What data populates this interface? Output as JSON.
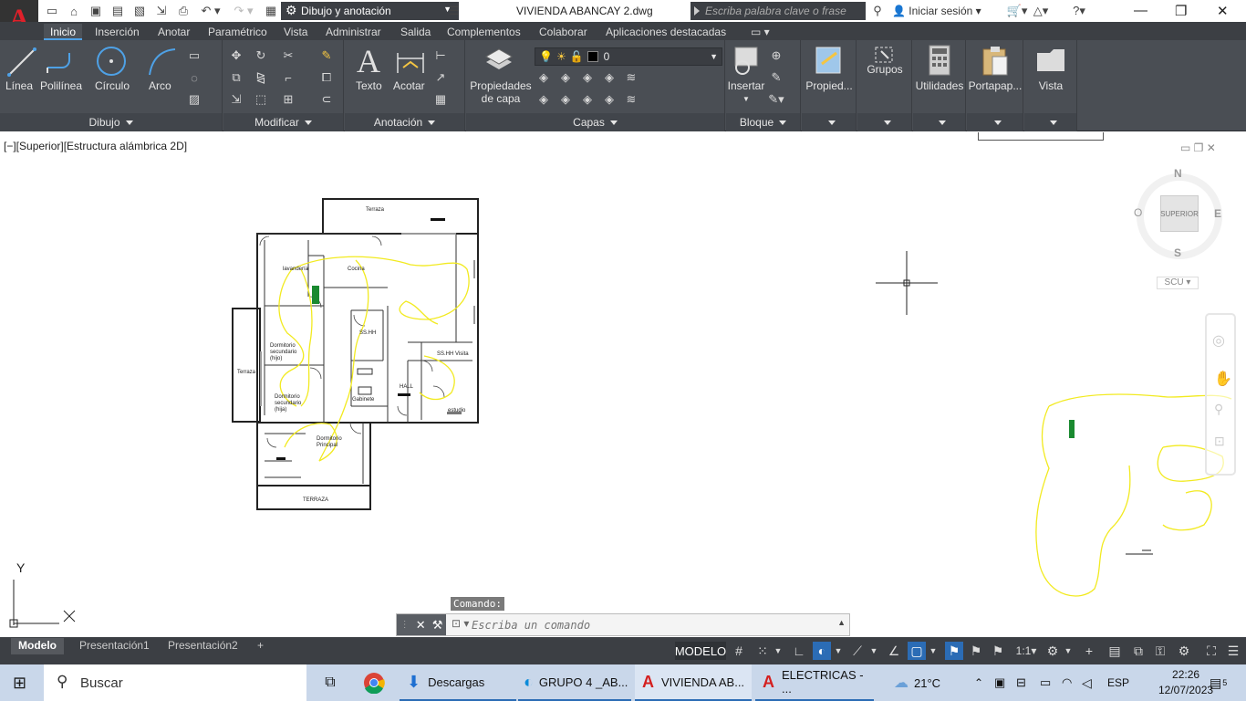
{
  "app": {
    "logo_letter": "A",
    "workspace": "Dibujo y anotación",
    "document_title": "VIVIENDA ABANCAY 2.dwg",
    "search_placeholder": "Escriba palabra clave o frase",
    "login": "Iniciar sesión"
  },
  "ribbon_tabs": [
    "Inicio",
    "Inserción",
    "Anotar",
    "Paramétrico",
    "Vista",
    "Administrar",
    "Salida",
    "Complementos",
    "Colaborar",
    "Aplicaciones destacadas"
  ],
  "panels": {
    "dibujo": {
      "title": "Dibujo",
      "tools": [
        "Línea",
        "Polilínea",
        "Círculo",
        "Arco"
      ]
    },
    "modificar": {
      "title": "Modificar"
    },
    "anotacion": {
      "title": "Anotación",
      "tools": [
        "Texto",
        "Acotar"
      ]
    },
    "capas": {
      "title": "Capas",
      "tool": "Propiedades de capa",
      "tool_line1": "Propiedades",
      "tool_line2": "de capa",
      "layer": "0"
    },
    "bloque": {
      "title": "Bloque",
      "tool": "Insertar"
    },
    "others": [
      "Propied...",
      "Grupos",
      "Utilidades",
      "Portapap...",
      "Vista"
    ]
  },
  "drawing": {
    "view_label": "[−][Superior][Estructura alámbrica 2D]",
    "viewcube": {
      "top_face": "SUPERIOR",
      "n": "N",
      "s": "S",
      "e": "E",
      "w": "O",
      "ucs": "SCU"
    },
    "ucs_y": "Y",
    "ucs_x": "X",
    "rooms": [
      {
        "label": "Terraza"
      },
      {
        "label": "lavandería"
      },
      {
        "label": "Cocina"
      },
      {
        "label": "SS.HH"
      },
      {
        "label": "SS.HH Visita"
      },
      {
        "label": "Dormitorio secundario (hijo)"
      },
      {
        "label": "Terraza"
      },
      {
        "label": "Dormitorio secundario (hija)"
      },
      {
        "label": "Gabinete"
      },
      {
        "label": "HALL"
      },
      {
        "label": "estudio"
      },
      {
        "label": "Dormitorio Principal"
      },
      {
        "label": "TERRAZA"
      }
    ]
  },
  "command": {
    "label": "Comando:",
    "placeholder": "Escriba un comando"
  },
  "layout_tabs": [
    "Modelo",
    "Presentación1",
    "Presentación2"
  ],
  "status": {
    "model": "MODELO",
    "scale": "1:1"
  },
  "taskbar": {
    "search": "Buscar",
    "apps": [
      "Descargas",
      "GRUPO 4 _AB...",
      "VIVIENDA AB...",
      "ELECTRICAS - ..."
    ],
    "weather": "21°C",
    "lang": "ESP",
    "time": "22:26",
    "date": "12/07/2023",
    "notifications": "5"
  }
}
